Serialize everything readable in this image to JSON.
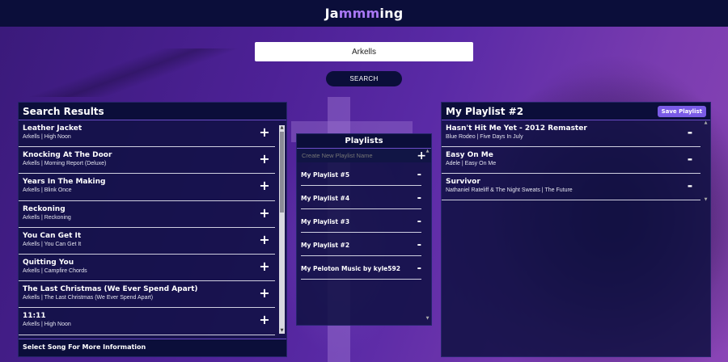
{
  "app": {
    "title_prefix": "Ja",
    "title_accent": "mmm",
    "title_suffix": "ing"
  },
  "search": {
    "value": "Arkells",
    "button_label": "SEARCH"
  },
  "results": {
    "title": "Search Results",
    "add_symbol": "+",
    "tracks": [
      {
        "name": "Leather Jacket",
        "info": "Arkells | High Noon"
      },
      {
        "name": "Knocking At The Door",
        "info": "Arkells | Morning Report (Deluxe)"
      },
      {
        "name": "Years In The Making",
        "info": "Arkells | Blink Once"
      },
      {
        "name": "Reckoning",
        "info": "Arkells | Reckoning"
      },
      {
        "name": "You Can Get It",
        "info": "Arkells | You Can Get It"
      },
      {
        "name": "Quitting You",
        "info": "Arkells | Campfire Chords"
      },
      {
        "name": "The Last Christmas (We Ever Spend Apart)",
        "info": "Arkells | The Last Christmas (We Ever Spend Apart)"
      },
      {
        "name": "11:11",
        "info": "Arkells | High Noon"
      }
    ],
    "footer": "Select Song For More Information"
  },
  "playlists": {
    "title": "Playlists",
    "new_placeholder": "Create New Playlist Name",
    "add_symbol": "+",
    "remove_symbol": "-",
    "items": [
      {
        "name": "My Playlist #5"
      },
      {
        "name": "My Playlist #4"
      },
      {
        "name": "My Playlist #3"
      },
      {
        "name": "My Playlist #2"
      },
      {
        "name": "My Peloton Music by kyle592"
      }
    ]
  },
  "playlist": {
    "title": "My Playlist #2",
    "save_label": "Save Playlist",
    "remove_symbol": "-",
    "tracks": [
      {
        "name": "Hasn't Hit Me Yet - 2012 Remaster",
        "info": "Blue Rodeo | Five Days In July"
      },
      {
        "name": "Easy On Me",
        "info": "Adele | Easy On Me"
      },
      {
        "name": "Survivor",
        "info": "Nathaniel Rateliff & The Night Sweats | The Future"
      }
    ]
  },
  "colors": {
    "header": "#0b0e3a",
    "accent": "#a978f5",
    "save_button": "#7a5be6"
  },
  "icons": {
    "add": "plus-icon",
    "remove": "minus-icon",
    "scroll_up": "scroll-up-arrow-icon",
    "scroll_down": "scroll-down-arrow-icon"
  }
}
